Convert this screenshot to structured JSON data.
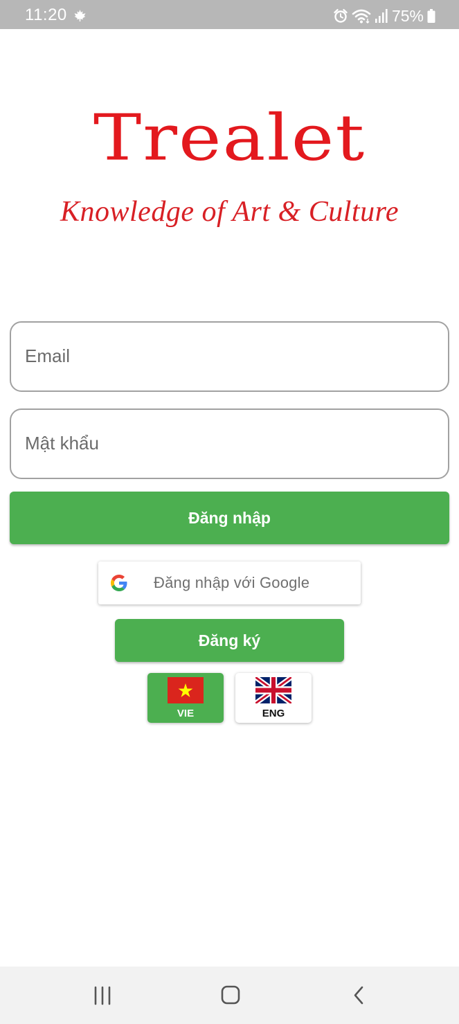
{
  "status_bar": {
    "time": "11:20",
    "battery_percent": "75%",
    "icons": [
      "leaf-notification-icon",
      "alarm-icon",
      "wifi-icon",
      "signal-icon",
      "battery-icon"
    ]
  },
  "logo": {
    "title": "Trealet",
    "tagline": "Knowledge of Art & Culture",
    "color": "#e3191e"
  },
  "login_form": {
    "email_placeholder": "Email",
    "email_value": "",
    "password_placeholder": "Mật khẩu",
    "password_value": "",
    "login_button": "Đăng nhập",
    "google_button": "Đăng nhập với Google",
    "register_button": "Đăng ký"
  },
  "language": {
    "options": [
      {
        "code": "VIE",
        "flag": "vietnam-flag-icon",
        "selected": true
      },
      {
        "code": "ENG",
        "flag": "uk-flag-icon",
        "selected": false
      }
    ]
  },
  "theme": {
    "accent": "#4caf50",
    "field_border": "#a1a1a1"
  },
  "nav_bar": {
    "icons": [
      "recent-apps-icon",
      "home-icon",
      "back-icon"
    ]
  }
}
